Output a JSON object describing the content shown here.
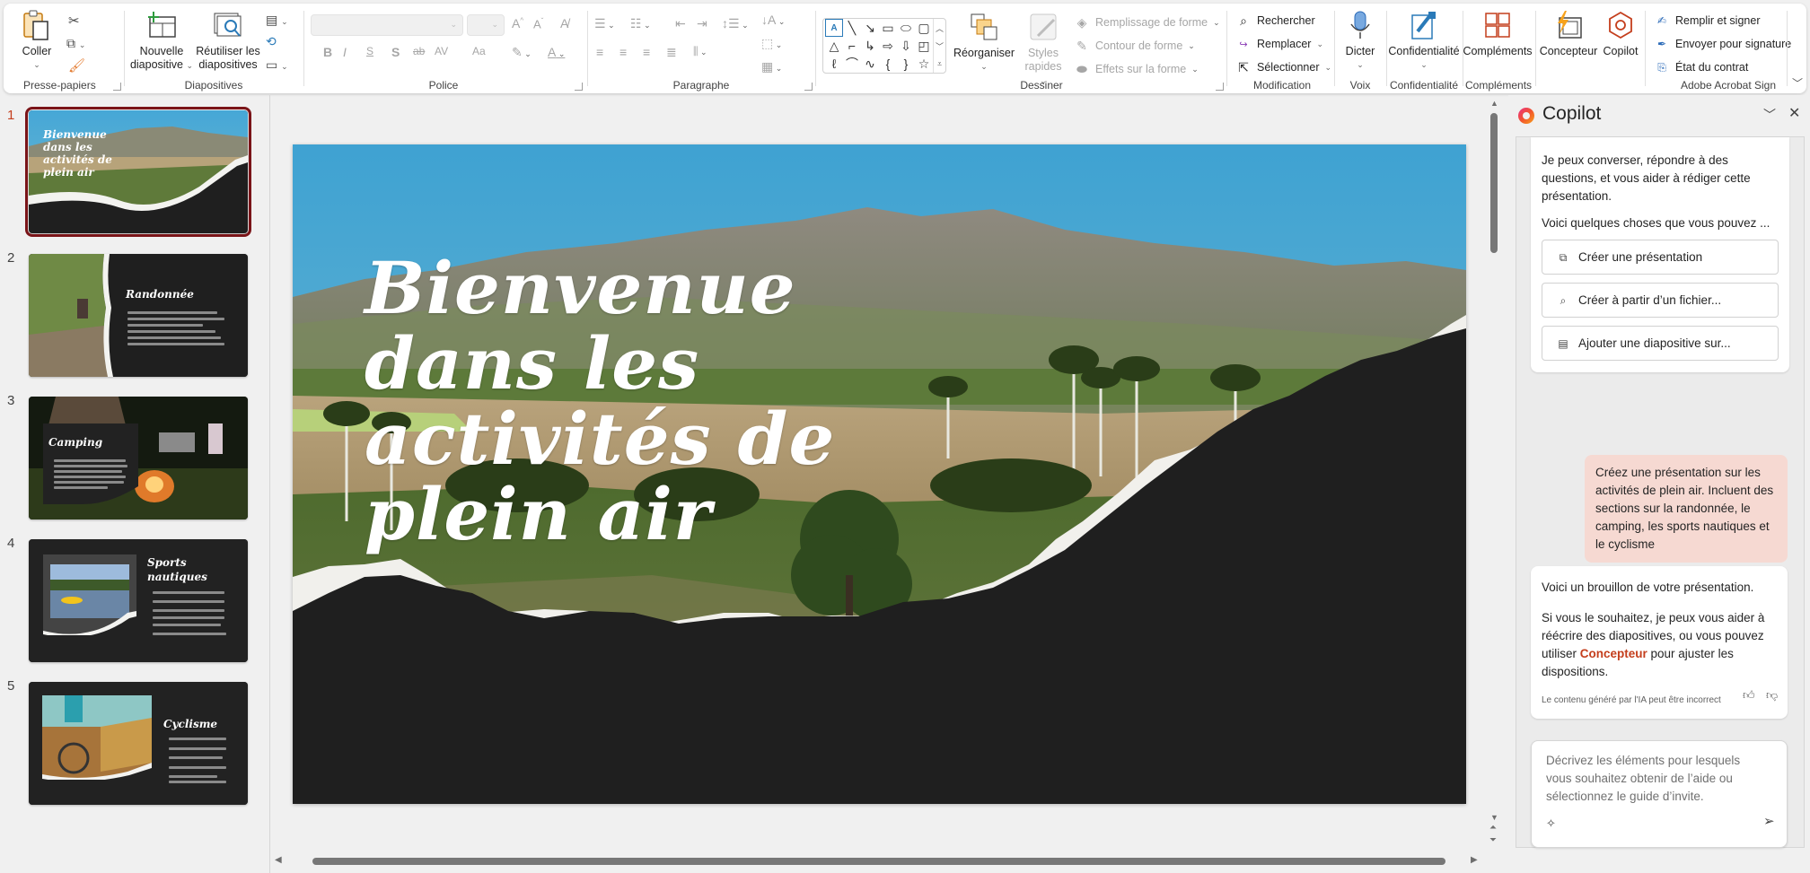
{
  "ribbon": {
    "clipboard": {
      "paste_label": "Coller",
      "group_label": "Presse-papiers",
      "icons": [
        "cut-icon",
        "copy-icon",
        "format-painter-icon"
      ]
    },
    "slides": {
      "new_slide_label_1": "Nouvelle",
      "new_slide_label_2": "diapositive",
      "reuse_label_1": "Réutiliser les",
      "reuse_label_2": "diapositives",
      "group_label": "Diapositives",
      "icons": [
        "layout-icon",
        "reset-icon",
        "section-icon"
      ]
    },
    "font": {
      "group_label": "Police",
      "font_name_value": "",
      "font_size_value": "",
      "buttons": [
        "B",
        "I",
        "S",
        "S",
        "ab",
        "AV",
        "Aa"
      ]
    },
    "paragraph": {
      "group_label": "Paragraphe"
    },
    "drawing": {
      "group_label": "Dessiner",
      "arrange_label": "Réorganiser",
      "quick_styles_label_1": "Styles",
      "quick_styles_label_2": "rapides",
      "shape_fill_label": "Remplissage de forme",
      "shape_outline_label": "Contour de forme",
      "shape_effects_label": "Effets sur la forme"
    },
    "editing": {
      "group_label": "Modification",
      "find_label": "Rechercher",
      "replace_label": "Remplacer",
      "select_label": "Sélectionner"
    },
    "voice": {
      "group_label": "Voix",
      "dictate_label": "Dicter"
    },
    "sensitivity": {
      "group_label": "Confidentialité",
      "button_label": "Confidentialité"
    },
    "addins": {
      "group_label": "Compléments",
      "button_label": "Compléments"
    },
    "designer_label": "Concepteur",
    "copilot_label": "Copilot",
    "acrobat": {
      "group_label": "Adobe Acrobat Sign",
      "fill_sign_label": "Remplir et signer",
      "send_signature_label": "Envoyer pour signature",
      "contract_status_label": "État du contrat"
    }
  },
  "thumbnails": [
    {
      "number": "1",
      "title": "Bienvenue dans les activités de plein air",
      "active": true
    },
    {
      "number": "2",
      "title": "Randonnée",
      "active": false
    },
    {
      "number": "3",
      "title": "Camping",
      "active": false
    },
    {
      "number": "4",
      "title": "Sports nautiques",
      "active": false
    },
    {
      "number": "5",
      "title": "Cyclisme",
      "active": false
    }
  ],
  "slide": {
    "title_lines": [
      "Bienvenue",
      "dans les",
      "activités de",
      "plein air"
    ]
  },
  "copilot": {
    "title": "Copilot",
    "intro_text": "Je peux converser, répondre à des questions, et vous aider à rédiger cette présentation.",
    "suggestions_header": "Voici quelques choses que vous pouvez ...",
    "suggestions": [
      {
        "label": "Créer une présentation",
        "icon": "slides-stack-icon"
      },
      {
        "label": "Créer à partir d’un fichier...",
        "icon": "file-search-icon"
      },
      {
        "label": "Ajouter une diapositive sur...",
        "icon": "slide-add-icon"
      }
    ],
    "user_message": "Créez une présentation sur les activités de plein air. Incluent des sections sur la randonnée, le camping, les sports nautiques et le cyclisme",
    "response_line1": "Voici un brouillon de votre présentation.",
    "response_p2_before": "Si vous le souhaitez, je peux vous aider à réécrire des diapositives, ou vous pouvez utiliser ",
    "response_p2_link": "Concepteur",
    "response_p2_after": " pour ajuster les dispositions.",
    "disclaimer": "Le contenu généré par l'IA peut être incorrect",
    "input_placeholder": "Décrivez les éléments pour lesquels vous souhaitez obtenir de l’aide ou sélectionnez le guide d’invite."
  },
  "colors": {
    "accent": "#c43e1c",
    "active_thumb_border": "#7a1418",
    "user_bubble": "#f6d9d2",
    "slide_dark": "#1f1f1f"
  }
}
